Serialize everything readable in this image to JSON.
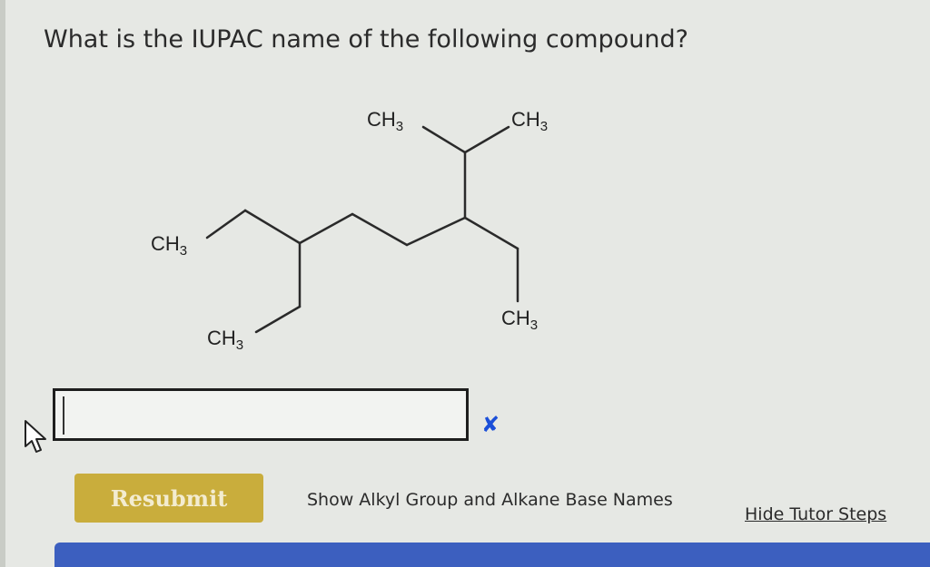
{
  "question": "What is the IUPAC name of the following compound?",
  "molecule": {
    "labels": {
      "ch3_top_left": "CH3",
      "ch3_top_right": "CH3",
      "ch3_left": "CH3",
      "ch3_lower_left": "CH3",
      "ch3_right": "CH3"
    }
  },
  "answer": {
    "value": "",
    "placeholder": "",
    "status_icon": "x-mark-icon",
    "status_color": "#1b4fd8"
  },
  "actions": {
    "resubmit_label": "Resubmit",
    "show_names_label": "Show Alkyl Group and Alkane Base Names",
    "hide_tutor_label": "Hide Tutor Steps"
  },
  "colors": {
    "resubmit_button": "#c9ad3c",
    "bottom_bar": "#3c5fbf"
  }
}
